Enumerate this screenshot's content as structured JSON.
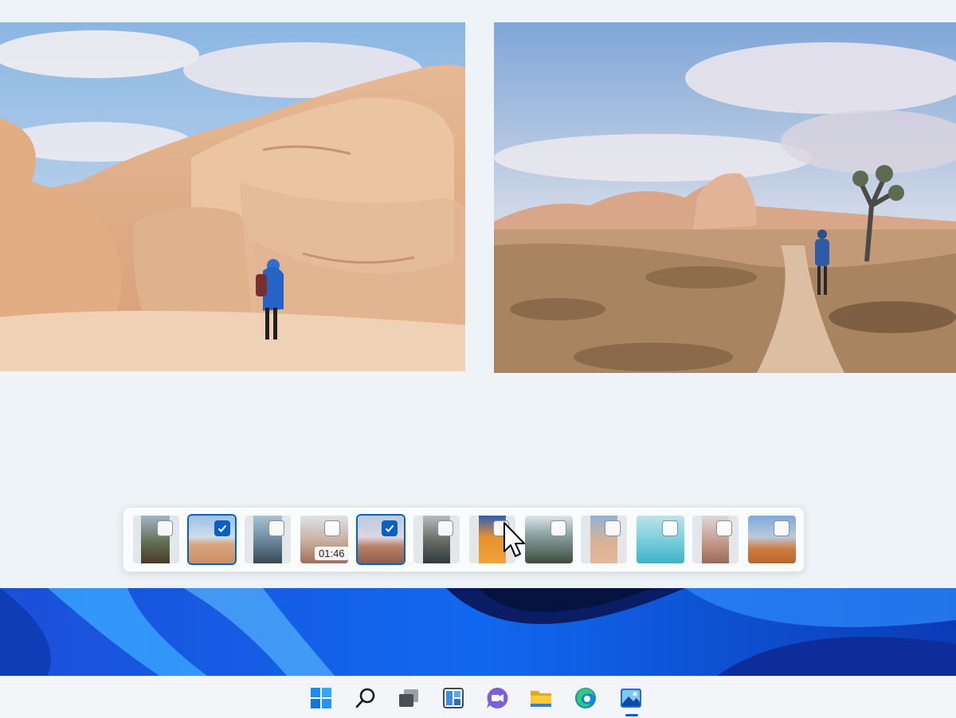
{
  "photos": {
    "left": {
      "name": "desert-rock-hiker"
    },
    "right": {
      "name": "joshua-tree-trail"
    }
  },
  "filmstrip": {
    "thumbnails": [
      {
        "selected": false
      },
      {
        "selected": true
      },
      {
        "selected": false
      },
      {
        "selected": false,
        "duration": "01:46"
      },
      {
        "selected": true
      },
      {
        "selected": false
      },
      {
        "selected": false
      },
      {
        "selected": false
      },
      {
        "selected": false
      },
      {
        "selected": false
      },
      {
        "selected": false
      },
      {
        "selected": false
      }
    ]
  },
  "taskbar": {
    "items": [
      "windows-start-icon",
      "search-icon",
      "task-view-icon",
      "widgets-icon",
      "chat-icon",
      "file-explorer-icon",
      "edge-browser-icon",
      "photos-app-icon"
    ],
    "active": "photos-app-icon"
  },
  "colors": {
    "accent": "#0a5fc2",
    "background": "#eef3f7"
  }
}
